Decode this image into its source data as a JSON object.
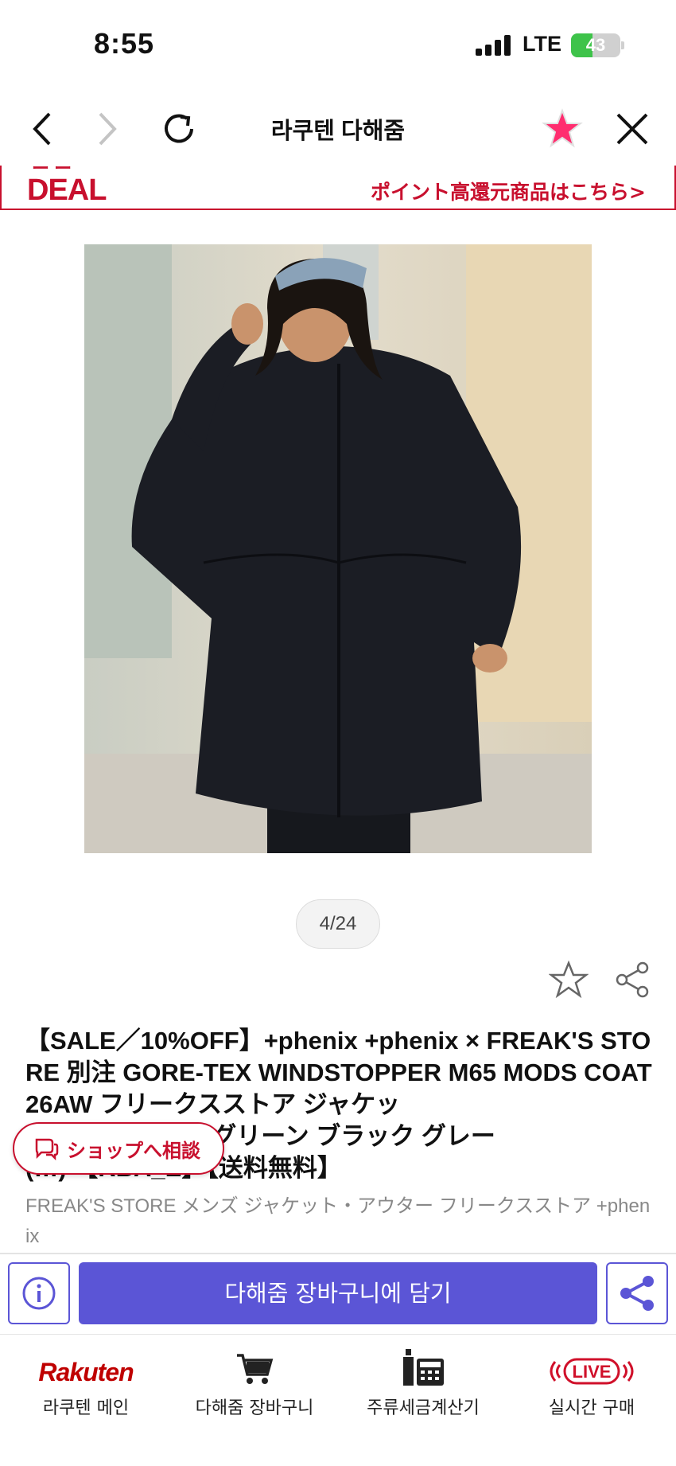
{
  "status_bar": {
    "time": "8:55",
    "network": "LTE",
    "battery": "43",
    "battery_level_percent": 43
  },
  "nav": {
    "title": "라쿠텐 다해줌"
  },
  "banner": {
    "deal_label": "DEAL",
    "link_text": "ポイント高還元商品はこちら>"
  },
  "gallery": {
    "page_indicator": "4/24"
  },
  "product": {
    "title": "【SALE／10%OFF】+phenix +phenix × FREAK'S STORE 別注 GORE-TEX WINDSTOPPER M65 MODS COAT 26AW フリークスストア ジャケッ",
    "title_line4": "ト モッズコート グリーン ブラック グレー",
    "title_line5": "(…) 【RBA_E】【送料無料】",
    "meta": "FREAK'S STORE メンズ ジャケット・アウター フリークスストア +phenix"
  },
  "chat": {
    "label": "ショップへ相談"
  },
  "actions": {
    "add_to_cart": "다해줌 장바구니에 담기"
  },
  "colors": {
    "accent": "#5b55d6",
    "rakuten_red": "#bf0000",
    "deal_red": "#c8102e",
    "favorite_pink": "#ff2d6f"
  },
  "tab_bar": {
    "items": [
      {
        "label": "라쿠텐 메인",
        "logo": "Rakuten",
        "icon": "rakuten-logo"
      },
      {
        "label": "다해줌 장바구니",
        "icon": "cart-icon"
      },
      {
        "label": "주류세금계산기",
        "icon": "liquor-calculator-icon"
      },
      {
        "label": "실시간 구매",
        "badge": "LIVE",
        "icon": "live-icon"
      }
    ]
  }
}
